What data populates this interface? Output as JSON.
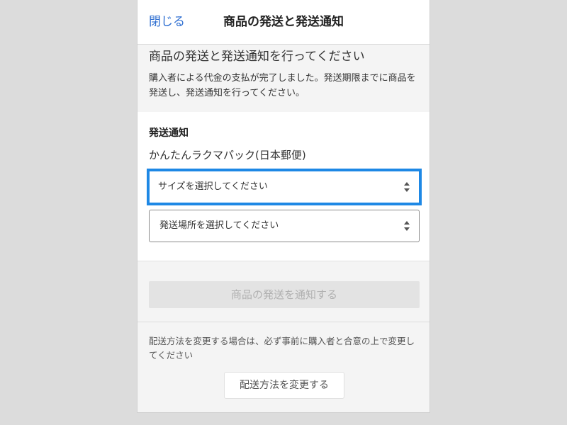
{
  "header": {
    "close_label": "閉じる",
    "title": "商品の発送と発送通知"
  },
  "intro": {
    "heading": "商品の発送と発送通知を行ってください",
    "body": "購入者による代金の支払が完了しました。発送期限までに商品を発送し、発送通知を行ってください。"
  },
  "notice": {
    "label": "発送通知",
    "method": "かんたんラクマパック(日本郵便)",
    "size_select": {
      "placeholder": "サイズを選択してください",
      "highlight_color": "#1e88e5"
    },
    "place_select": {
      "placeholder": "発送場所を選択してください"
    }
  },
  "actions": {
    "notify_label": "商品の発送を通知する",
    "change_note": "配送方法を変更する場合は、必ず事前に購入者と合意の上で変更してください",
    "change_label": "配送方法を変更する"
  },
  "colors": {
    "link": "#2f6fd1",
    "background": "#f4f4f4",
    "disabled_button": "#e3e3e3"
  }
}
